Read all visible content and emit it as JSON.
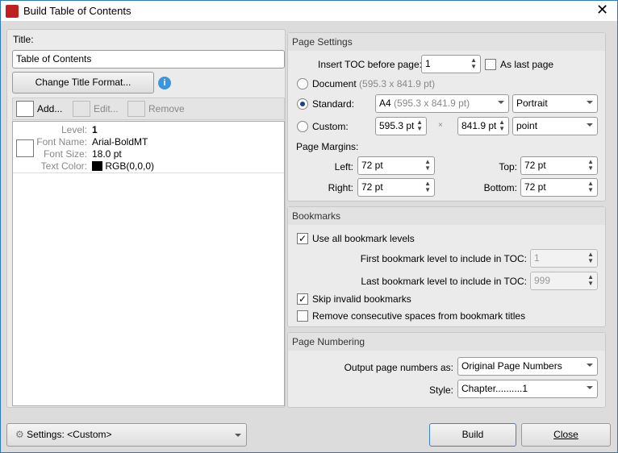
{
  "window": {
    "title": "Build Table of Contents",
    "close": "✕"
  },
  "left": {
    "title_label": "Title:",
    "title_value": "Table of Contents",
    "change_format": "Change Title Format...",
    "toolbar": {
      "add": "Add...",
      "edit": "Edit...",
      "remove": "Remove"
    },
    "entry": {
      "level_label": "Level:",
      "level": "1",
      "font_name_label": "Font Name:",
      "font_name": "Arial-BoldMT",
      "font_size_label": "Font Size:",
      "font_size": "18.0 pt",
      "text_color_label": "Text Color:",
      "text_color": "RGB(0,0,0)",
      "swatch": "#000000"
    }
  },
  "page_settings": {
    "header": "Page Settings",
    "insert_label": "Insert TOC before page:",
    "insert_value": "1",
    "as_last_page": "As last page",
    "as_last_checked": false,
    "document_label": "Document",
    "document_size": "(595.3 x 841.9 pt)",
    "standard_label": "Standard:",
    "standard_value": "A4",
    "standard_size": "(595.3 x 841.9 pt)",
    "orientation": "Portrait",
    "custom_label": "Custom:",
    "custom_w": "595.3 pt",
    "times": "×",
    "custom_h": "841.9 pt",
    "unit": "point",
    "selected": "standard",
    "margins_label": "Page Margins:",
    "left_label": "Left:",
    "left": "72 pt",
    "top_label": "Top:",
    "top": "72 pt",
    "right_label": "Right:",
    "right": "72 pt",
    "bottom_label": "Bottom:",
    "bottom": "72 pt"
  },
  "bookmarks": {
    "header": "Bookmarks",
    "use_all": "Use all bookmark levels",
    "use_all_checked": true,
    "first_label": "First bookmark level to include in TOC:",
    "first": "1",
    "last_label": "Last bookmark level to include in TOC:",
    "last": "999",
    "skip_invalid": "Skip invalid bookmarks",
    "skip_checked": true,
    "remove_spaces": "Remove consecutive spaces from bookmark titles",
    "remove_checked": false
  },
  "numbering": {
    "header": "Page Numbering",
    "output_label": "Output page numbers as:",
    "output": "Original Page Numbers",
    "style_label": "Style:",
    "style": "Chapter..........1"
  },
  "footer": {
    "settings_label": "Settings:",
    "settings_value": "<Custom>",
    "build": "Build",
    "close": "Close"
  }
}
